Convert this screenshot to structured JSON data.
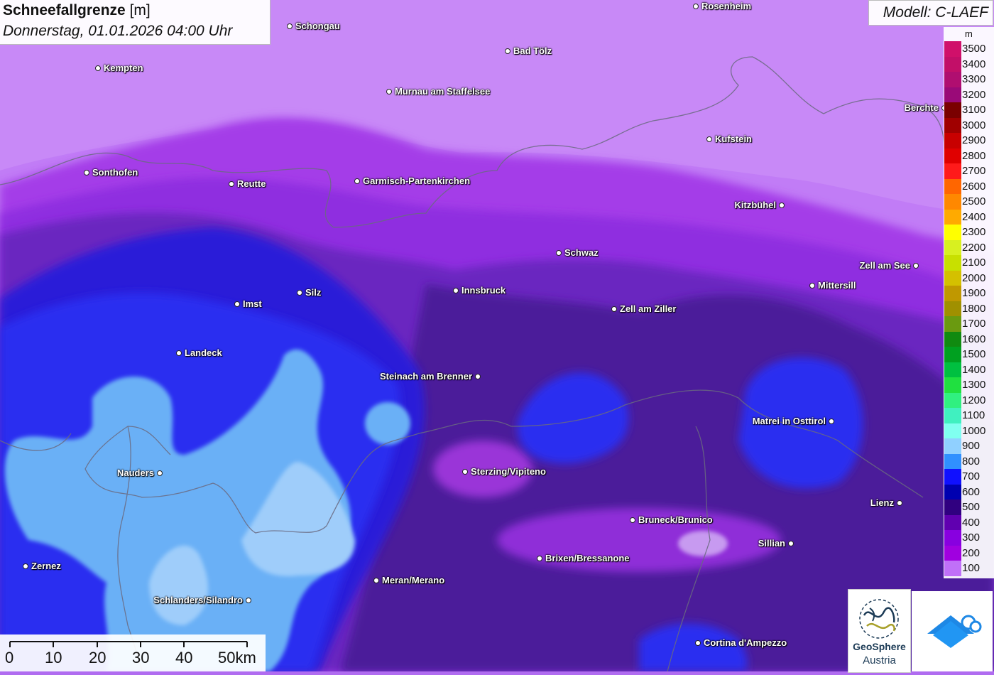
{
  "title": {
    "param": "Schneefallgrenze",
    "unit": "[m]",
    "datetime": "Donnerstag, 01.01.2026 04:00 Uhr"
  },
  "model": "Modell: C-LAEF",
  "legend": {
    "unit": "m",
    "items": [
      {
        "label": "3500",
        "color": "#d0106a"
      },
      {
        "label": "3400",
        "color": "#c20f68"
      },
      {
        "label": "3300",
        "color": "#b00e70"
      },
      {
        "label": "3200",
        "color": "#9a0a78"
      },
      {
        "label": "3100",
        "color": "#7a0000"
      },
      {
        "label": "3000",
        "color": "#a00000"
      },
      {
        "label": "2900",
        "color": "#c80000"
      },
      {
        "label": "2800",
        "color": "#e00000"
      },
      {
        "label": "2700",
        "color": "#ff1a1a"
      },
      {
        "label": "2600",
        "color": "#ff6600"
      },
      {
        "label": "2500",
        "color": "#ff8800"
      },
      {
        "label": "2400",
        "color": "#ffaa00"
      },
      {
        "label": "2300",
        "color": "#ffff00"
      },
      {
        "label": "2200",
        "color": "#d8f020"
      },
      {
        "label": "2100",
        "color": "#c8e000"
      },
      {
        "label": "2000",
        "color": "#d4c000"
      },
      {
        "label": "1900",
        "color": "#c09800"
      },
      {
        "label": "1800",
        "color": "#a09000"
      },
      {
        "label": "1700",
        "color": "#6a9a10"
      },
      {
        "label": "1600",
        "color": "#108a10"
      },
      {
        "label": "1500",
        "color": "#00a020"
      },
      {
        "label": "1400",
        "color": "#00c040"
      },
      {
        "label": "1300",
        "color": "#20e040"
      },
      {
        "label": "1200",
        "color": "#30f080"
      },
      {
        "label": "1100",
        "color": "#40f0c0"
      },
      {
        "label": "1000",
        "color": "#80fff0"
      },
      {
        "label": "900",
        "color": "#90d0ff"
      },
      {
        "label": "800",
        "color": "#3090ff"
      },
      {
        "label": "700",
        "color": "#1010ff"
      },
      {
        "label": "600",
        "color": "#0000b0"
      },
      {
        "label": "500",
        "color": "#300080"
      },
      {
        "label": "400",
        "color": "#6000b0"
      },
      {
        "label": "300",
        "color": "#8800e0"
      },
      {
        "label": "200",
        "color": "#a000e0"
      },
      {
        "label": "100",
        "color": "#c070f8"
      }
    ]
  },
  "cities": [
    {
      "name": "Schongau"
    },
    {
      "name": "Rosenheim"
    },
    {
      "name": "Bad Tölz"
    },
    {
      "name": "Kempten"
    },
    {
      "name": "Murnau am Staffelsee"
    },
    {
      "name": "Kufstein"
    },
    {
      "name": "Sonthofen"
    },
    {
      "name": "Reutte"
    },
    {
      "name": "Garmisch-Partenkirchen"
    },
    {
      "name": "Kitzbühel"
    },
    {
      "name": "Berchte"
    },
    {
      "name": "Schwaz"
    },
    {
      "name": "Zell am See"
    },
    {
      "name": "Innsbruck"
    },
    {
      "name": "Silz"
    },
    {
      "name": "Imst"
    },
    {
      "name": "Mittersill"
    },
    {
      "name": "Zell am Ziller"
    },
    {
      "name": "Landeck"
    },
    {
      "name": "Steinach am Brenner"
    },
    {
      "name": "Matrei in Osttirol"
    },
    {
      "name": "Nauders"
    },
    {
      "name": "Sterzing/Vipiteno"
    },
    {
      "name": "Lienz"
    },
    {
      "name": "Bruneck/Brunico"
    },
    {
      "name": "Sillian"
    },
    {
      "name": "Brixen/Bressanone"
    },
    {
      "name": "Zernez"
    },
    {
      "name": "Meran/Merano"
    },
    {
      "name": "Schlanders/Silandro"
    },
    {
      "name": "Cortina d'Ampezzo"
    }
  ],
  "scalebar": {
    "labels": [
      "0",
      "10",
      "20",
      "30",
      "40",
      "50km"
    ]
  },
  "logos": {
    "geosphere_line1": "GeoSphere",
    "geosphere_line2": "Austria"
  }
}
